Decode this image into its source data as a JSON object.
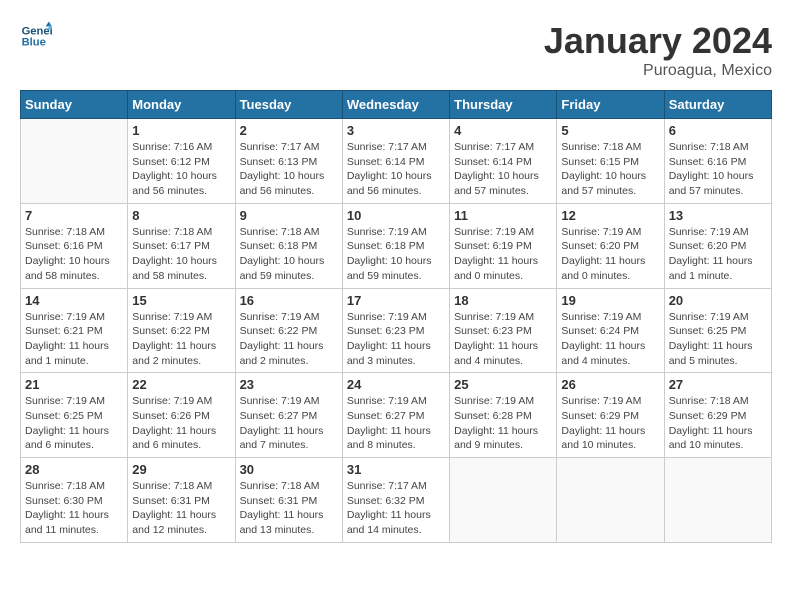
{
  "header": {
    "logo_line1": "General",
    "logo_line2": "Blue",
    "month_title": "January 2024",
    "location": "Puroagua, Mexico"
  },
  "weekdays": [
    "Sunday",
    "Monday",
    "Tuesday",
    "Wednesday",
    "Thursday",
    "Friday",
    "Saturday"
  ],
  "weeks": [
    [
      {
        "day": "",
        "sunrise": "",
        "sunset": "",
        "daylight": ""
      },
      {
        "day": "1",
        "sunrise": "Sunrise: 7:16 AM",
        "sunset": "Sunset: 6:12 PM",
        "daylight": "Daylight: 10 hours and 56 minutes."
      },
      {
        "day": "2",
        "sunrise": "Sunrise: 7:17 AM",
        "sunset": "Sunset: 6:13 PM",
        "daylight": "Daylight: 10 hours and 56 minutes."
      },
      {
        "day": "3",
        "sunrise": "Sunrise: 7:17 AM",
        "sunset": "Sunset: 6:14 PM",
        "daylight": "Daylight: 10 hours and 56 minutes."
      },
      {
        "day": "4",
        "sunrise": "Sunrise: 7:17 AM",
        "sunset": "Sunset: 6:14 PM",
        "daylight": "Daylight: 10 hours and 57 minutes."
      },
      {
        "day": "5",
        "sunrise": "Sunrise: 7:18 AM",
        "sunset": "Sunset: 6:15 PM",
        "daylight": "Daylight: 10 hours and 57 minutes."
      },
      {
        "day": "6",
        "sunrise": "Sunrise: 7:18 AM",
        "sunset": "Sunset: 6:16 PM",
        "daylight": "Daylight: 10 hours and 57 minutes."
      }
    ],
    [
      {
        "day": "7",
        "sunrise": "Sunrise: 7:18 AM",
        "sunset": "Sunset: 6:16 PM",
        "daylight": "Daylight: 10 hours and 58 minutes."
      },
      {
        "day": "8",
        "sunrise": "Sunrise: 7:18 AM",
        "sunset": "Sunset: 6:17 PM",
        "daylight": "Daylight: 10 hours and 58 minutes."
      },
      {
        "day": "9",
        "sunrise": "Sunrise: 7:18 AM",
        "sunset": "Sunset: 6:18 PM",
        "daylight": "Daylight: 10 hours and 59 minutes."
      },
      {
        "day": "10",
        "sunrise": "Sunrise: 7:19 AM",
        "sunset": "Sunset: 6:18 PM",
        "daylight": "Daylight: 10 hours and 59 minutes."
      },
      {
        "day": "11",
        "sunrise": "Sunrise: 7:19 AM",
        "sunset": "Sunset: 6:19 PM",
        "daylight": "Daylight: 11 hours and 0 minutes."
      },
      {
        "day": "12",
        "sunrise": "Sunrise: 7:19 AM",
        "sunset": "Sunset: 6:20 PM",
        "daylight": "Daylight: 11 hours and 0 minutes."
      },
      {
        "day": "13",
        "sunrise": "Sunrise: 7:19 AM",
        "sunset": "Sunset: 6:20 PM",
        "daylight": "Daylight: 11 hours and 1 minute."
      }
    ],
    [
      {
        "day": "14",
        "sunrise": "Sunrise: 7:19 AM",
        "sunset": "Sunset: 6:21 PM",
        "daylight": "Daylight: 11 hours and 1 minute."
      },
      {
        "day": "15",
        "sunrise": "Sunrise: 7:19 AM",
        "sunset": "Sunset: 6:22 PM",
        "daylight": "Daylight: 11 hours and 2 minutes."
      },
      {
        "day": "16",
        "sunrise": "Sunrise: 7:19 AM",
        "sunset": "Sunset: 6:22 PM",
        "daylight": "Daylight: 11 hours and 2 minutes."
      },
      {
        "day": "17",
        "sunrise": "Sunrise: 7:19 AM",
        "sunset": "Sunset: 6:23 PM",
        "daylight": "Daylight: 11 hours and 3 minutes."
      },
      {
        "day": "18",
        "sunrise": "Sunrise: 7:19 AM",
        "sunset": "Sunset: 6:23 PM",
        "daylight": "Daylight: 11 hours and 4 minutes."
      },
      {
        "day": "19",
        "sunrise": "Sunrise: 7:19 AM",
        "sunset": "Sunset: 6:24 PM",
        "daylight": "Daylight: 11 hours and 4 minutes."
      },
      {
        "day": "20",
        "sunrise": "Sunrise: 7:19 AM",
        "sunset": "Sunset: 6:25 PM",
        "daylight": "Daylight: 11 hours and 5 minutes."
      }
    ],
    [
      {
        "day": "21",
        "sunrise": "Sunrise: 7:19 AM",
        "sunset": "Sunset: 6:25 PM",
        "daylight": "Daylight: 11 hours and 6 minutes."
      },
      {
        "day": "22",
        "sunrise": "Sunrise: 7:19 AM",
        "sunset": "Sunset: 6:26 PM",
        "daylight": "Daylight: 11 hours and 6 minutes."
      },
      {
        "day": "23",
        "sunrise": "Sunrise: 7:19 AM",
        "sunset": "Sunset: 6:27 PM",
        "daylight": "Daylight: 11 hours and 7 minutes."
      },
      {
        "day": "24",
        "sunrise": "Sunrise: 7:19 AM",
        "sunset": "Sunset: 6:27 PM",
        "daylight": "Daylight: 11 hours and 8 minutes."
      },
      {
        "day": "25",
        "sunrise": "Sunrise: 7:19 AM",
        "sunset": "Sunset: 6:28 PM",
        "daylight": "Daylight: 11 hours and 9 minutes."
      },
      {
        "day": "26",
        "sunrise": "Sunrise: 7:19 AM",
        "sunset": "Sunset: 6:29 PM",
        "daylight": "Daylight: 11 hours and 10 minutes."
      },
      {
        "day": "27",
        "sunrise": "Sunrise: 7:18 AM",
        "sunset": "Sunset: 6:29 PM",
        "daylight": "Daylight: 11 hours and 10 minutes."
      }
    ],
    [
      {
        "day": "28",
        "sunrise": "Sunrise: 7:18 AM",
        "sunset": "Sunset: 6:30 PM",
        "daylight": "Daylight: 11 hours and 11 minutes."
      },
      {
        "day": "29",
        "sunrise": "Sunrise: 7:18 AM",
        "sunset": "Sunset: 6:31 PM",
        "daylight": "Daylight: 11 hours and 12 minutes."
      },
      {
        "day": "30",
        "sunrise": "Sunrise: 7:18 AM",
        "sunset": "Sunset: 6:31 PM",
        "daylight": "Daylight: 11 hours and 13 minutes."
      },
      {
        "day": "31",
        "sunrise": "Sunrise: 7:17 AM",
        "sunset": "Sunset: 6:32 PM",
        "daylight": "Daylight: 11 hours and 14 minutes."
      },
      {
        "day": "",
        "sunrise": "",
        "sunset": "",
        "daylight": ""
      },
      {
        "day": "",
        "sunrise": "",
        "sunset": "",
        "daylight": ""
      },
      {
        "day": "",
        "sunrise": "",
        "sunset": "",
        "daylight": ""
      }
    ]
  ]
}
